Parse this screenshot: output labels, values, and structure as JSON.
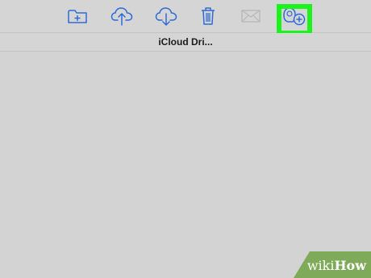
{
  "toolbar": {
    "buttons": [
      {
        "icon": "new-folder-icon",
        "enabled": true
      },
      {
        "icon": "cloud-upload-icon",
        "enabled": true
      },
      {
        "icon": "cloud-download-icon",
        "enabled": true
      },
      {
        "icon": "trash-icon",
        "enabled": true
      },
      {
        "icon": "mail-icon",
        "enabled": false
      },
      {
        "icon": "add-people-icon",
        "enabled": true,
        "highlighted": true
      }
    ]
  },
  "window": {
    "title": "iCloud Dri..."
  },
  "watermark": {
    "part1": "wiki",
    "part2": "How"
  },
  "colors": {
    "accent": "#2f6bd6",
    "disabled": "#b8b8b8",
    "highlight": "#1cf21c",
    "background": "#d3d3d3",
    "watermark": "#7eaa5a"
  }
}
